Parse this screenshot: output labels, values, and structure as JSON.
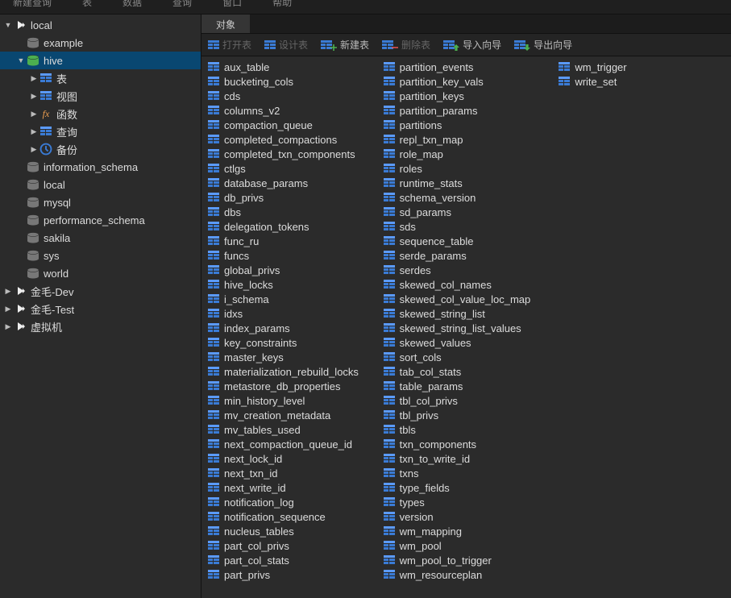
{
  "menubar": [
    "新建查询",
    "表",
    "数据",
    "查询",
    "窗口",
    "帮助"
  ],
  "tab": {
    "label": "对象"
  },
  "toolbar": {
    "open": "打开表",
    "design": "设计表",
    "newtable": "新建表",
    "delete": "删除表",
    "importw": "导入向导",
    "exportw": "导出向导"
  },
  "tree": [
    {
      "label": "local",
      "icon": "conn",
      "depth": 0,
      "expanded": true
    },
    {
      "label": "example",
      "icon": "db",
      "depth": 1
    },
    {
      "label": "hive",
      "icon": "db-active",
      "depth": 1,
      "expanded": true,
      "selected": true
    },
    {
      "label": "表",
      "icon": "table",
      "depth": 2,
      "expandable": true
    },
    {
      "label": "视图",
      "icon": "table",
      "depth": 2,
      "expandable": true
    },
    {
      "label": "函数",
      "icon": "fx",
      "depth": 2,
      "expandable": true
    },
    {
      "label": "查询",
      "icon": "query",
      "depth": 2,
      "expandable": true
    },
    {
      "label": "备份",
      "icon": "clock",
      "depth": 2,
      "expandable": true
    },
    {
      "label": "information_schema",
      "icon": "db",
      "depth": 1
    },
    {
      "label": "local",
      "icon": "db",
      "depth": 1
    },
    {
      "label": "mysql",
      "icon": "db",
      "depth": 1
    },
    {
      "label": "performance_schema",
      "icon": "db",
      "depth": 1
    },
    {
      "label": "sakila",
      "icon": "db",
      "depth": 1
    },
    {
      "label": "sys",
      "icon": "db",
      "depth": 1
    },
    {
      "label": "world",
      "icon": "db",
      "depth": 1
    },
    {
      "label": "金毛-Dev",
      "icon": "conn-off",
      "depth": 0
    },
    {
      "label": "金毛-Test",
      "icon": "conn-off",
      "depth": 0
    },
    {
      "label": "虚拟机",
      "icon": "conn-off",
      "depth": 0
    }
  ],
  "tables": [
    "aux_table",
    "bucketing_cols",
    "cds",
    "columns_v2",
    "compaction_queue",
    "completed_compactions",
    "completed_txn_components",
    "ctlgs",
    "database_params",
    "db_privs",
    "dbs",
    "delegation_tokens",
    "func_ru",
    "funcs",
    "global_privs",
    "hive_locks",
    "i_schema",
    "idxs",
    "index_params",
    "key_constraints",
    "master_keys",
    "materialization_rebuild_locks",
    "metastore_db_properties",
    "min_history_level",
    "mv_creation_metadata",
    "mv_tables_used",
    "next_compaction_queue_id",
    "next_lock_id",
    "next_txn_id",
    "next_write_id",
    "notification_log",
    "notification_sequence",
    "nucleus_tables",
    "part_col_privs",
    "part_col_stats",
    "part_privs",
    "partition_events",
    "partition_key_vals",
    "partition_keys",
    "partition_params",
    "partitions",
    "repl_txn_map",
    "role_map",
    "roles",
    "runtime_stats",
    "schema_version",
    "sd_params",
    "sds",
    "sequence_table",
    "serde_params",
    "serdes",
    "skewed_col_names",
    "skewed_col_value_loc_map",
    "skewed_string_list",
    "skewed_string_list_values",
    "skewed_values",
    "sort_cols",
    "tab_col_stats",
    "table_params",
    "tbl_col_privs",
    "tbl_privs",
    "tbls",
    "txn_components",
    "txn_to_write_id",
    "txns",
    "type_fields",
    "types",
    "version",
    "wm_mapping",
    "wm_pool",
    "wm_pool_to_trigger",
    "wm_resourceplan",
    "wm_trigger",
    "write_set"
  ]
}
